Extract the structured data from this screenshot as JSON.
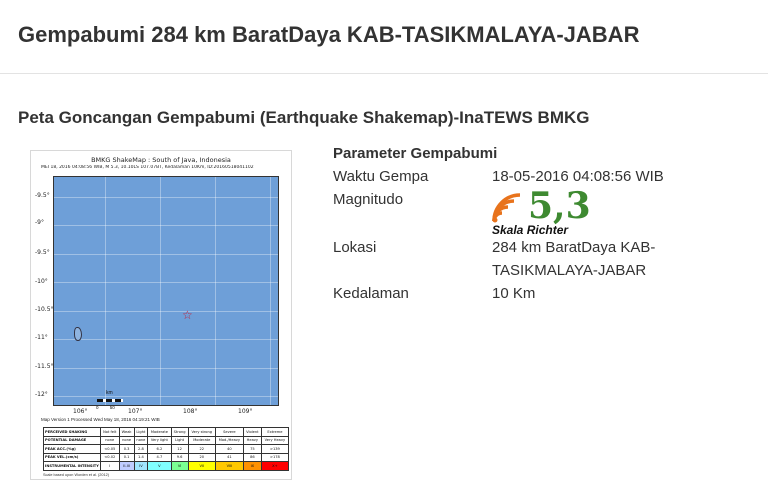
{
  "header": {
    "title": "Gempabumi 284 km BaratDaya KAB-TASIKMALAYA-JABAR"
  },
  "section": {
    "title": "Peta Goncangan Gempabumi (Earthquake Shakemap)-InaTEWS BMKG"
  },
  "shakemap": {
    "title": "BMKG ShakeMap : South of Java, Indonesia",
    "subtitle": "MEI 18, 2016 04:08:56 WIB, M 5.3, 10.10LS 107.07BT, Kedalaman 10Km, ID:20160518041102",
    "lat_labels": [
      "-9.5°",
      "-9°",
      "-9.5°",
      "-10°",
      "-10.5°",
      "-11°",
      "-11.5°",
      "-12°"
    ],
    "lon_labels": [
      "106°",
      "107°",
      "108°",
      "109°"
    ],
    "scale_unit": "km",
    "scale_ticks": [
      "0",
      "50"
    ],
    "footer": "Map Version 1 Processed Wed May 18, 2016 04:19:21 WIB",
    "table": [
      [
        "PERCEIVED SHAKING",
        "Not felt",
        "Weak",
        "Light",
        "Moderate",
        "Strong",
        "Very strong",
        "Severe",
        "Violent",
        "Extreme"
      ],
      [
        "POTENTIAL DAMAGE",
        "none",
        "none",
        "none",
        "Very light",
        "Light",
        "Moderate",
        "Mod./Heavy",
        "Heavy",
        "Very Heavy"
      ],
      [
        "PEAK ACC.(%g)",
        "<0.05",
        "0.3",
        "2.8",
        "6.2",
        "12",
        "22",
        "40",
        "75",
        ">139"
      ],
      [
        "PEAK VEL.(cm/s)",
        "<0.02",
        "0.1",
        "1.4",
        "4.7",
        "9.6",
        "20",
        "41",
        "86",
        ">178"
      ],
      [
        "INSTRUMENTAL INTENSITY",
        "I",
        "II-III",
        "IV",
        "V",
        "VI",
        "VII",
        "VIII",
        "IX",
        "X+"
      ]
    ],
    "intensity_colors": [
      "#ffffff",
      "#bfccff",
      "#a0e6ff",
      "#80ffff",
      "#7aff93",
      "#ffff00",
      "#ffc800",
      "#ff9100",
      "#ff0000",
      "#c80000"
    ],
    "table_footer": "Scale based upon Worden et al. (2012)"
  },
  "params": {
    "title": "Parameter Gempabumi",
    "waktu_label": "Waktu Gempa",
    "waktu_value": "18-05-2016 04:08:56 WIB",
    "magnitudo_label": "Magnitudo",
    "magnitudo_value": "5,3",
    "magnitudo_scale": "Skala Richter",
    "lokasi_label": "Lokasi",
    "lokasi_line1": "284 km BaratDaya KAB-",
    "lokasi_line2": "TASIKMALAYA-JABAR",
    "kedalaman_label": "Kedalaman",
    "kedalaman_value": "10 Km"
  },
  "colors": {
    "magnitude": "#3e8a31",
    "signal": "#e8731c",
    "map_sea": "#6e9fd8",
    "epicenter": "#c2213a"
  }
}
